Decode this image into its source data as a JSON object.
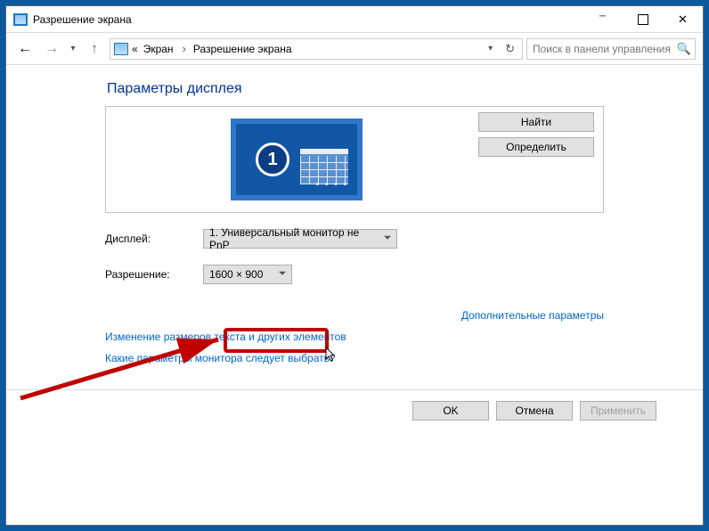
{
  "window": {
    "title": "Разрешение экрана"
  },
  "nav": {
    "breadcrumb": [
      {
        "label": "Экран"
      },
      {
        "label": "Разрешение экрана"
      }
    ],
    "search_placeholder": "Поиск в панели управления"
  },
  "heading": "Параметры дисплея",
  "monitor": {
    "number": "1"
  },
  "buttons": {
    "find": "Найти",
    "identify": "Определить",
    "ok": "OK",
    "cancel": "Отмена",
    "apply": "Применить"
  },
  "labels": {
    "display": "Дисплей:",
    "resolution": "Разрешение:"
  },
  "values": {
    "display": "1. Универсальный монитор не PnP",
    "resolution": "1600 × 900"
  },
  "links": {
    "advanced": "Дополнительные параметры",
    "resize": "Изменение размеров текста и других элементов",
    "which": "Какие параметры монитора следует выбрать?"
  },
  "annotation": {
    "highlight_target": "resolution-dropdown",
    "color": "#c00000"
  }
}
